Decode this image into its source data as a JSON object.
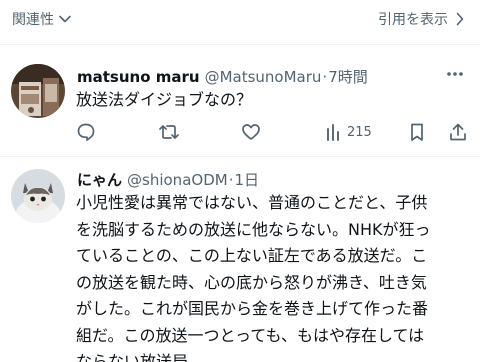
{
  "topbar": {
    "sort_label": "関連性",
    "quotes_label": "引用を表示"
  },
  "posts": [
    {
      "display_name": "matsuno maru",
      "handle": "@MatsunoMaru",
      "separator": "·",
      "time": "7時間",
      "text": "放送法ダイジョブなの？",
      "views": "215",
      "icons": [
        "reply-icon",
        "repost-icon",
        "like-icon",
        "views-icon",
        "bookmark-icon",
        "share-icon",
        "more-icon"
      ]
    },
    {
      "display_name": "にゃん",
      "handle": "@shionaODM",
      "separator": "·",
      "time": "1日",
      "text": "小児性愛は異常ではない、普通のことだと、子供\nを洗脳するための放送に他ならない。NHKが狂っ\nていることの、この上ない証左である放送だ。こ\nの放送を観た時、心の底から怒りが沸き、吐き気\nがした。これが国民から金を巻き上げて作った番\n組だ。この放送一つとっても、もはや存在しては\nならない放送局。"
    }
  ],
  "colors": {
    "text": "#0f1419",
    "secondary": "#536471",
    "divider": "#eff3f4"
  }
}
